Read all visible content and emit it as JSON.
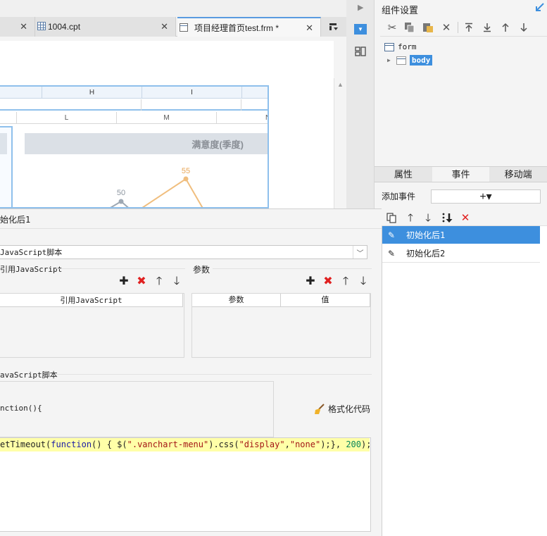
{
  "tabs": [
    {
      "label": ""
    },
    {
      "label": "1004.cpt"
    },
    {
      "label": "项目经理首页test.frm *"
    }
  ],
  "canvas": {
    "columns_top": [
      "H",
      "I"
    ],
    "columns_second": [
      "L",
      "M",
      "N"
    ],
    "chart_title": "满意度(季度)",
    "chart_points": [
      {
        "label": "50",
        "series": "gray"
      },
      {
        "label": "55",
        "series": "orange"
      }
    ],
    "colors": {
      "gray_series": "#9ea8b3",
      "orange_series": "#f0be7e",
      "selection": "#8fc0ec"
    }
  },
  "component_settings": {
    "title": "组件设置",
    "toolbar_icons": [
      "cut-icon",
      "copy-icon",
      "paste-icon",
      "delete-icon",
      "move-top-icon",
      "move-bottom-icon",
      "move-up-icon",
      "move-down-icon"
    ],
    "tree": {
      "form": "form",
      "body": "body"
    }
  },
  "property_tabs": [
    "属性",
    "事件",
    "移动端"
  ],
  "events": {
    "add_label": "添加事件",
    "add_symbol": "+▾",
    "items": [
      {
        "label": "初始化后1",
        "selected": true
      },
      {
        "label": "初始化后2",
        "selected": false
      }
    ]
  },
  "editor": {
    "event_name": "始化后1",
    "type_value": "JavaScript脚本",
    "ref_js_label": "引用JavaScript",
    "param_label": "参数",
    "ref_table_header": "引用JavaScript",
    "param_table_headers": [
      "参数",
      "值"
    ],
    "script_label": "avaScript脚本",
    "function_text": "nction(){",
    "format_button": "格式化代码",
    "code": {
      "part1": "etTimeout(",
      "kw_function": "function",
      "part2": "() { $(",
      "str1": "\".vanchart-menu\"",
      "part3": ").css(",
      "str2": "\"display\"",
      "part4": ",",
      "str3": "\"none\"",
      "part5": ");}, ",
      "num": "200",
      "part6": ");"
    }
  }
}
